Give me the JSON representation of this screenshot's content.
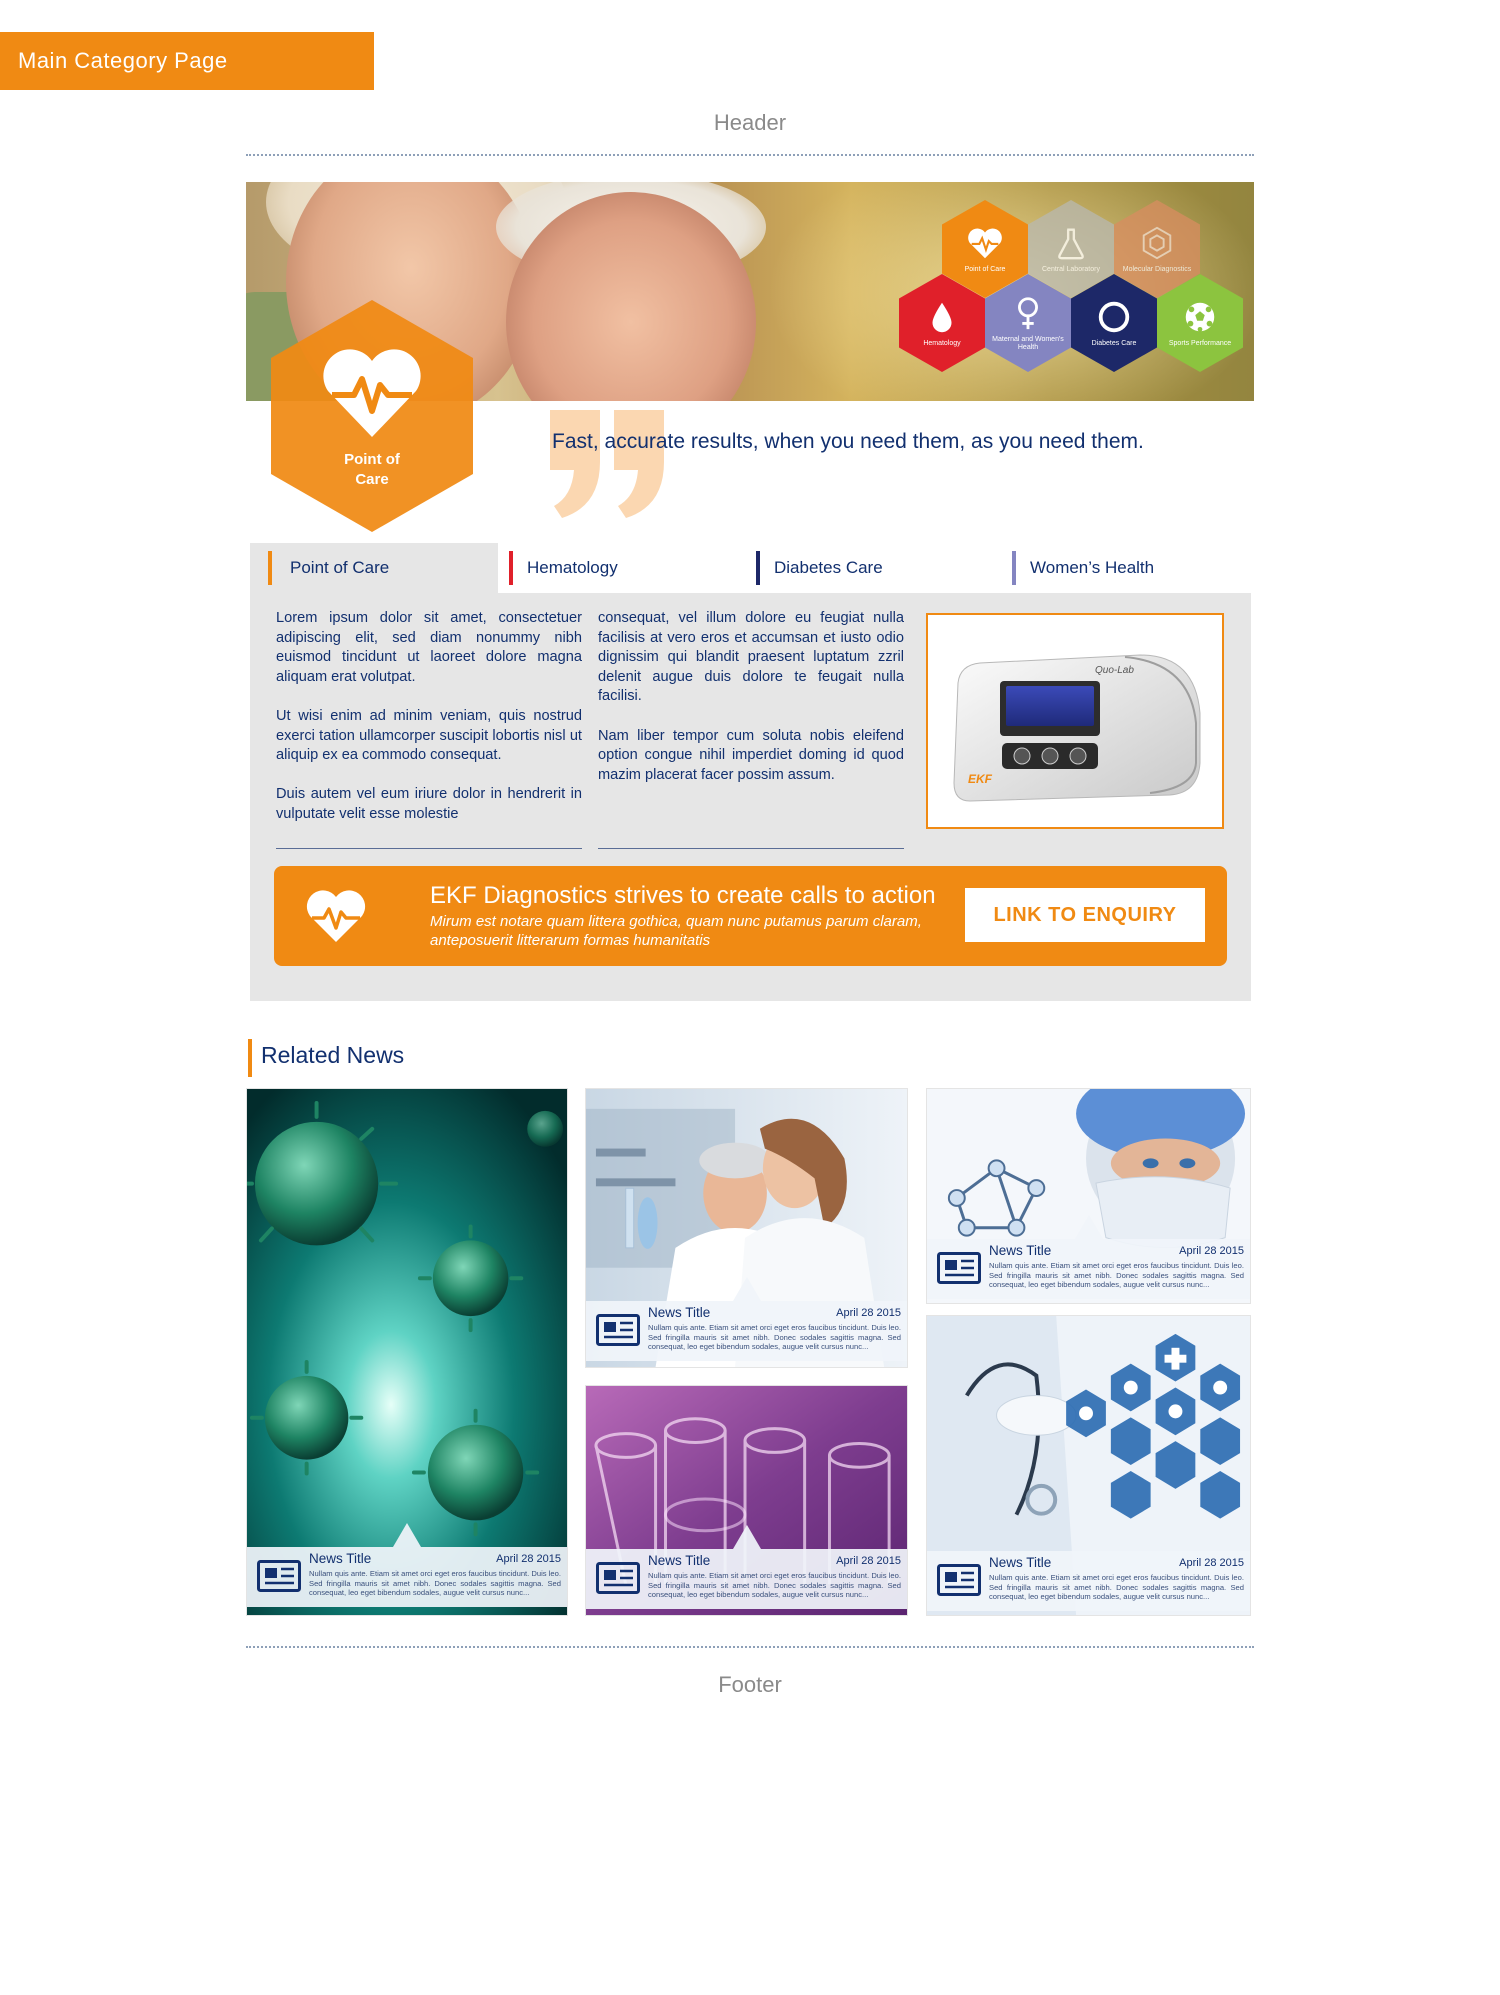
{
  "page_label": "Main Category Page",
  "header_label": "Header",
  "footer_label": "Footer",
  "hero": {
    "hexagons": [
      {
        "label": "Point of Care",
        "icon": "heart-pulse-icon",
        "color": "#f08a13"
      },
      {
        "label": "Central Laboratory",
        "icon": "flask-icon",
        "color": "#b9b8b0"
      },
      {
        "label": "Molecular Diagnostics",
        "icon": "molecule-icon",
        "color": "#d98d61"
      },
      {
        "label": "Hematology",
        "icon": "blood-drop-icon",
        "color": "#e0202a"
      },
      {
        "label": "Maternal and Women's Health",
        "icon": "female-icon",
        "color": "#8485c1"
      },
      {
        "label": "Diabetes Care",
        "icon": "circle-icon",
        "color": "#1d2868"
      },
      {
        "label": "Sports Performance",
        "icon": "football-icon",
        "color": "#8cc43f"
      }
    ],
    "badge_label": "Point of Care",
    "tagline": "Fast, accurate results, when you need them, as you need them."
  },
  "tabs": [
    {
      "label": "Point of Care",
      "color": "#f08a13",
      "active": true
    },
    {
      "label": "Hematology",
      "color": "#e0202a",
      "active": false
    },
    {
      "label": "Diabetes Care",
      "color": "#1d2868",
      "active": false
    },
    {
      "label": "Women’s Health",
      "color": "#8485c1",
      "active": false
    }
  ],
  "content": {
    "col1": [
      "Lorem ipsum dolor sit amet, consectetuer adipiscing elit, sed diam nonummy nibh euismod tincidunt ut laoreet dolore magna aliquam erat volutpat.",
      "Ut wisi enim ad minim veniam, quis nostrud exerci tation ullamcorper suscipit lobortis nisl ut aliquip ex ea commodo consequat.",
      "Duis autem vel eum iriure dolor in hendrerit in vulputate velit esse molestie"
    ],
    "col2": [
      "consequat, vel illum dolore eu feugiat nulla facilisis at vero eros et accumsan et iusto odio dignissim qui blandit praesent luptatum zzril delenit augue duis dolore te feugait nulla facilisi.",
      "Nam liber tempor cum soluta nobis eleifend option congue nihil imperdiet doming id quod mazim placerat facer possim assum."
    ],
    "product_brand": "Quo-Lab",
    "product_logo": "EKF"
  },
  "cta": {
    "title": "EKF Diagnostics strives to create calls to action",
    "subtitle": "Mirum est notare quam littera gothica, quam nunc putamus parum claram, anteposuerit litterarum formas humanitatis",
    "button": "LINK TO ENQUIRY"
  },
  "related_news": {
    "title": "Related News",
    "cards": [
      {
        "title": "News Title",
        "date": "April 28 2015",
        "text": "Nullam quis ante. Etiam sit amet orci eget eros faucibus tincidunt. Duis leo. Sed fringilla mauris sit amet nibh. Donec sodales sagittis magna. Sed consequat, leo eget bibendum sodales, augue velit cursus nunc..."
      },
      {
        "title": "News Title",
        "date": "April 28 2015",
        "text": "Nullam quis ante. Etiam sit amet orci eget eros faucibus tincidunt. Duis leo. Sed fringilla mauris sit amet nibh. Donec sodales sagittis magna. Sed consequat, leo eget bibendum sodales, augue velit cursus nunc..."
      },
      {
        "title": "News Title",
        "date": "April 28 2015",
        "text": "Nullam quis ante. Etiam sit amet orci eget eros faucibus tincidunt. Duis leo. Sed fringilla mauris sit amet nibh. Donec sodales sagittis magna. Sed consequat, leo eget bibendum sodales, augue velit cursus nunc..."
      },
      {
        "title": "News Title",
        "date": "April 28 2015",
        "text": "Nullam quis ante. Etiam sit amet orci eget eros faucibus tincidunt. Duis leo. Sed fringilla mauris sit amet nibh. Donec sodales sagittis magna. Sed consequat, leo eget bibendum sodales, augue velit cursus nunc..."
      },
      {
        "title": "News Title",
        "date": "April 28 2015",
        "text": "Nullam quis ante. Etiam sit amet orci eget eros faucibus tincidunt. Duis leo. Sed fringilla mauris sit amet nibh. Donec sodales sagittis magna. Sed consequat, leo eget bibendum sodales, augue velit cursus nunc..."
      }
    ]
  },
  "colors": {
    "accent": "#f08a13",
    "navy": "#12306f",
    "panel": "#e6e6e6"
  }
}
